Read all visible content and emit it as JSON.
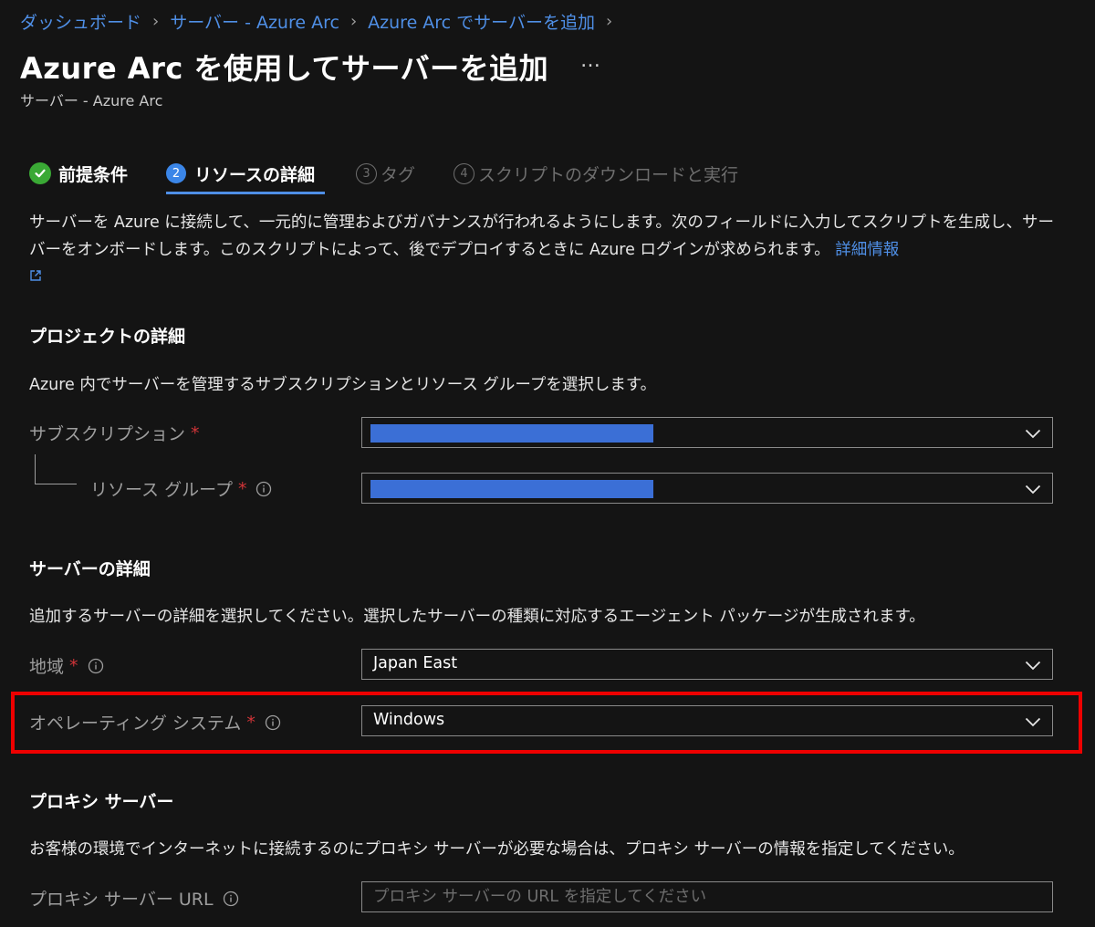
{
  "breadcrumb": {
    "items": [
      "ダッシュボード",
      "サーバー - Azure Arc",
      "Azure Arc でサーバーを追加"
    ]
  },
  "header": {
    "title": "Azure Arc を使用してサーバーを追加",
    "more": "…",
    "subtitle": "サーバー - Azure Arc"
  },
  "tabs": [
    {
      "label": "前提条件",
      "status": "done"
    },
    {
      "label": "リソースの詳細",
      "number": "2",
      "status": "active"
    },
    {
      "label": "タグ",
      "number": "3",
      "status": "pending"
    },
    {
      "label": "スクリプトのダウンロードと実行",
      "number": "4",
      "status": "pending"
    }
  ],
  "intro": {
    "text": "サーバーを Azure に接続して、一元的に管理およびガバナンスが行われるようにします。次のフィールドに入力してスクリプトを生成し、サーバーをオンボードします。このスクリプトによって、後でデプロイするときに Azure ログインが求められます。",
    "link": "詳細情報"
  },
  "project": {
    "title": "プロジェクトの詳細",
    "description": "Azure 内でサーバーを管理するサブスクリプションとリソース グループを選択します。",
    "subscription_label": "サブスクリプション",
    "resource_group_label": "リソース グループ"
  },
  "server": {
    "title": "サーバーの詳細",
    "description": "追加するサーバーの詳細を選択してください。選択したサーバーの種類に対応するエージェント パッケージが生成されます。",
    "region_label": "地域",
    "region_value": "Japan East",
    "os_label": "オペレーティング システム",
    "os_value": "Windows"
  },
  "proxy": {
    "title": "プロキシ サーバー",
    "description": "お客様の環境でインターネットに接続するのにプロキシ サーバーが必要な場合は、プロキシ サーバーの情報を指定してください。",
    "url_label": "プロキシ サーバー URL",
    "url_placeholder": "プロキシ サーバーの URL を指定してください"
  },
  "required_mark": "*",
  "colors": {
    "accent": "#4f8fe6",
    "success": "#3aa935",
    "required": "#d13438",
    "highlight": "#ee0000"
  }
}
